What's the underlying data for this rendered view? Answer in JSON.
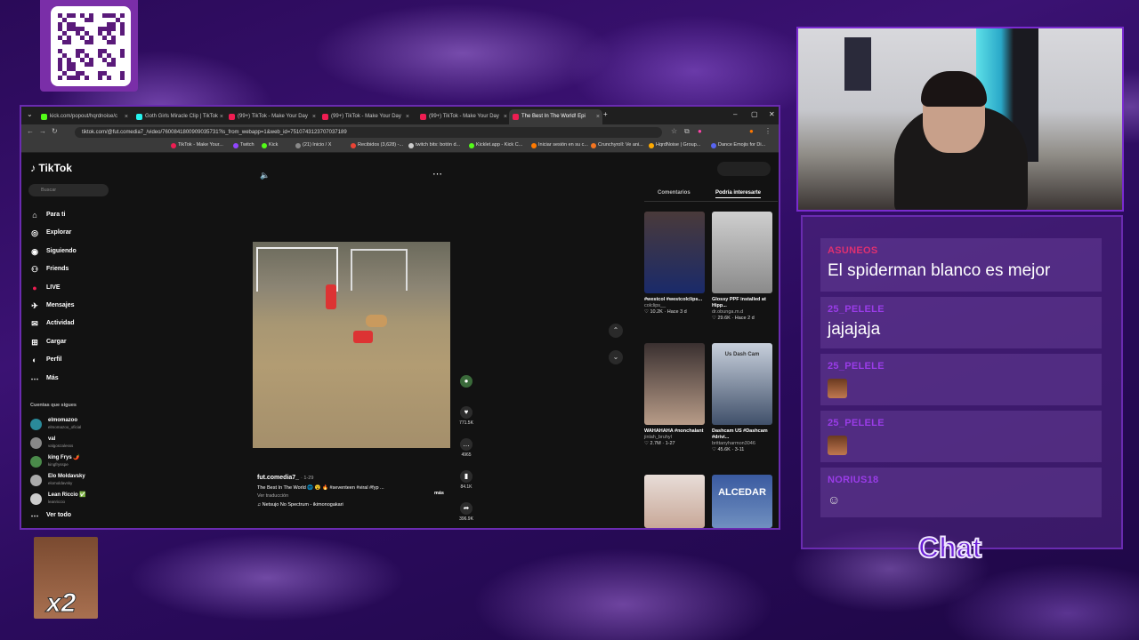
{
  "browser": {
    "tabs": [
      {
        "label": "kick.com/popout/hqrdnoise/c",
        "color": "#53fc18"
      },
      {
        "label": "Goth Girls Miracle Clip | TikTok",
        "color": "#25f4ee"
      },
      {
        "label": "(99+) TikTok - Make Your Day",
        "color": "#ee1d52"
      },
      {
        "label": "(99+) TikTok - Make Your Day",
        "color": "#ee1d52"
      },
      {
        "label": "(99+) TikTok - Make Your Day",
        "color": "#ee1d52"
      },
      {
        "label": "The Best In The World! Epi",
        "color": "#ee1d52"
      }
    ],
    "url": "tiktok.com/@fut.comedia7_/video/7600841800909035731?is_from_webapp=1&web_id=7510743123707037189",
    "bookmarks": [
      {
        "label": "TikTok - Make Your...",
        "color": "#ee1d52"
      },
      {
        "label": "Twitch",
        "color": "#9146ff"
      },
      {
        "label": "Kick",
        "color": "#53fc18"
      },
      {
        "label": "(21) Inicio / X",
        "color": "#888888"
      },
      {
        "label": "Recibidos (3,628) -...",
        "color": "#ea4335"
      },
      {
        "label": "twitch bits: botón d...",
        "color": "#cccccc"
      },
      {
        "label": "Kicklet.app - Kick C...",
        "color": "#53fc18"
      },
      {
        "label": "Iniciar sesión en su c...",
        "color": "#ff7a00"
      },
      {
        "label": "Crunchyroll: Ve ani...",
        "color": "#f47521"
      },
      {
        "label": "HqrdNoise | Group...",
        "color": "#ffaa00"
      },
      {
        "label": "Dance Emojis for Di...",
        "color": "#5865f2"
      }
    ]
  },
  "tiktok": {
    "logo": "TikTok",
    "search_placeholder": "Buscar",
    "nav": [
      {
        "label": "Para ti",
        "icon": "home-icon"
      },
      {
        "label": "Explorar",
        "icon": "compass-icon"
      },
      {
        "label": "Siguiendo",
        "icon": "following-icon"
      },
      {
        "label": "Friends",
        "icon": "friends-icon"
      },
      {
        "label": "LIVE",
        "icon": "live-icon"
      },
      {
        "label": "Mensajes",
        "icon": "messages-icon"
      },
      {
        "label": "Actividad",
        "icon": "activity-icon"
      },
      {
        "label": "Cargar",
        "icon": "upload-icon"
      },
      {
        "label": "Perfil",
        "icon": "profile-icon"
      },
      {
        "label": "Más",
        "icon": "more-icon"
      }
    ],
    "following_title": "Cuentas que sigues",
    "following": [
      {
        "name": "elmomazoo",
        "handle": "elmomazoo_oficial"
      },
      {
        "name": "val",
        "handle": "valgonzalesss"
      },
      {
        "name": "king Frys 🌶️",
        "handle": "kingfrysspe"
      },
      {
        "name": "Elo Moldavsky",
        "handle": "elomoldavsky"
      },
      {
        "name": "Lean Riccio ✅",
        "handle": "leanriccio"
      }
    ],
    "see_all": "Ver todo",
    "video": {
      "username": "fut.comedia7_",
      "date": "· 1-29",
      "description": "The Best In The World 🌐 😮 🔥 #seventeen #viral #fyp ...",
      "more": "más",
      "translate": "Ver traducción",
      "music": "Netsujo No Spectrum - ikimonogakari",
      "likes": "771.5K",
      "comments": "4965",
      "saves": "84.1K",
      "shares": "396.9K"
    },
    "right_tabs": [
      "Comentarios",
      "Podría interesarte"
    ],
    "suggestions": [
      {
        "title": "#westcol #westcolclips...",
        "user": "colclips__",
        "stats": "♡ 10.2K · Hace 3 d",
        "color1": "#4a3a3a",
        "color2": "#1a2a6a"
      },
      {
        "title": "Glossy PPF installed at Hipp...",
        "user": "dr.obunga.m.d",
        "stats": "♡ 29.6K · Hace 2 d",
        "color1": "#cfcfcf",
        "color2": "#8a8a8a"
      },
      {
        "title": "WAHAHAHA #nonchalant",
        "user": "jinlah_bruhyl",
        "stats": "♡ 2.7M · 1-27",
        "color1": "#3a3030",
        "color2": "#b89c88"
      },
      {
        "title": "Dashcam US #Dashcam #drivi...",
        "user": "brittanyharmon3046",
        "stats": "♡ 45.6K · 3-11",
        "color1": "#c8d0dc",
        "color2": "#40506a"
      },
      {
        "title": "",
        "user": "",
        "stats": "",
        "color1": "#e8ddd8",
        "color2": "#c8a898"
      },
      {
        "title": "",
        "user": "",
        "stats": "",
        "color1": "#3a5aa0",
        "color2": "#7090c0"
      }
    ],
    "thumb_overlay_text": [
      "Us Dash Cam",
      "ALCEDAR"
    ]
  },
  "chat": {
    "messages": [
      {
        "user": "ASUNEOS",
        "text": "El spiderman blanco es mejor",
        "emote": ""
      },
      {
        "user": "25_PELELE",
        "text": "jajajaja",
        "emote": ""
      },
      {
        "user": "25_PELELE",
        "text": "",
        "emote": "laughing-face-emote"
      },
      {
        "user": "25_PELELE",
        "text": "",
        "emote": "laughing-face-emote"
      },
      {
        "user": "NORIUS18",
        "text": "",
        "emote": "small-character-emote"
      }
    ],
    "label": "Chat"
  },
  "overlay": {
    "multiplier": "x2"
  }
}
